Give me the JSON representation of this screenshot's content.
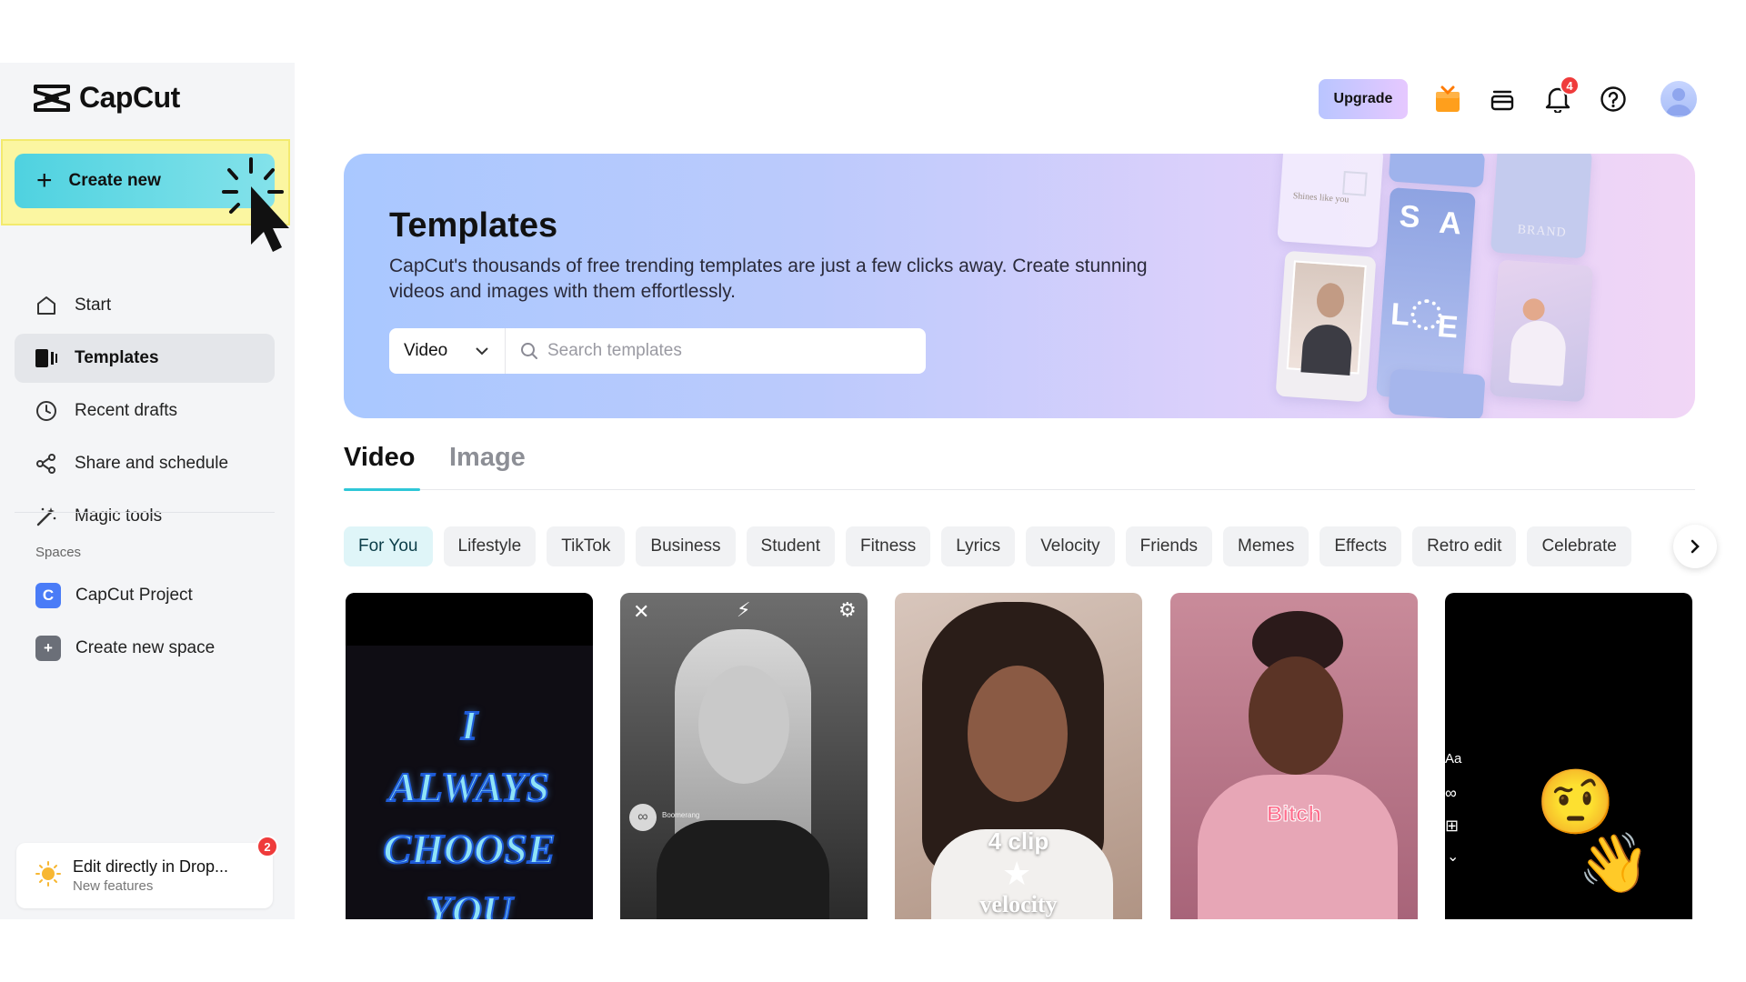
{
  "brand": {
    "name": "CapCut"
  },
  "sidebar": {
    "create_label": "Create new",
    "items": [
      {
        "label": "Start",
        "icon": "home-icon"
      },
      {
        "label": "Templates",
        "icon": "templates-icon"
      },
      {
        "label": "Recent drafts",
        "icon": "clock-icon"
      },
      {
        "label": "Share and schedule",
        "icon": "share-icon"
      },
      {
        "label": "Magic tools",
        "icon": "magic-wand-icon"
      }
    ],
    "spaces_label": "Spaces",
    "spaces": [
      {
        "label": "CapCut Project",
        "badge": "C",
        "color": "#4a7cf7"
      },
      {
        "label": "Create new space",
        "badge": "+",
        "color": "#6b6f78"
      }
    ],
    "promo": {
      "title": "Edit directly in Drop...",
      "subtitle": "New features",
      "badge": "2"
    }
  },
  "topbar": {
    "upgrade_label": "Upgrade",
    "notification_count": "4"
  },
  "banner": {
    "title": "Templates",
    "description": "CapCut's thousands of free trending templates are just a few clicks away. Create stunning videos and images with them effortlessly.",
    "select_value": "Video",
    "search_placeholder": "Search templates",
    "mockup_texts": [
      "Shines like you",
      "S",
      "A",
      "BRAND",
      "L",
      "E"
    ]
  },
  "tabs": [
    {
      "label": "Video"
    },
    {
      "label": "Image"
    }
  ],
  "chips": [
    "For You",
    "Lifestyle",
    "TikTok",
    "Business",
    "Student",
    "Fitness",
    "Lyrics",
    "Velocity",
    "Friends",
    "Memes",
    "Effects",
    "Retro edit",
    "Celebrate"
  ],
  "cards": [
    {
      "lines": [
        "I",
        "ALWAYS",
        "CHOOSE",
        "YOU"
      ]
    },
    {
      "side_text": "Boomerang"
    },
    {
      "overlay_top": "4 clip",
      "overlay_bottom": "velocity"
    },
    {
      "overlay": "Bitch"
    },
    {
      "side_icons": [
        "Aa",
        "∞",
        "⊞",
        "⌄"
      ],
      "emojis": [
        "🤨",
        "👋"
      ]
    }
  ],
  "colors": {
    "accent": "#2ec7d7",
    "sidebar_bg": "#f4f5f7",
    "highlight": "#fbf6a1",
    "notification_red": "#ef3b3b"
  }
}
